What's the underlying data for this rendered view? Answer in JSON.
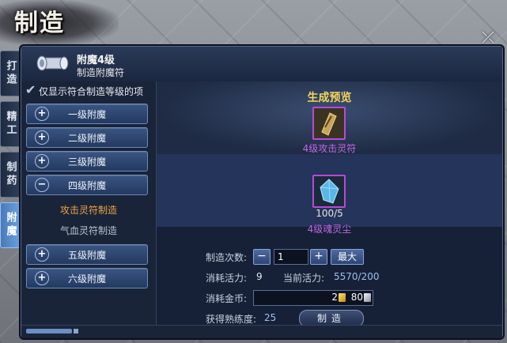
{
  "window": {
    "title": "制造",
    "close_icon": "close-x-icon"
  },
  "side_tabs": [
    {
      "label": "打造",
      "active": false
    },
    {
      "label": "精工",
      "active": false
    },
    {
      "label": "制药",
      "active": false
    },
    {
      "label": "附魔",
      "active": true
    }
  ],
  "header": {
    "item_name": "附魔4级",
    "item_sub": "制造附魔符"
  },
  "filter": {
    "label": "仅显示符合制造等级的项",
    "checked": true
  },
  "categories": [
    {
      "label": "一级附魔",
      "sign": "+"
    },
    {
      "label": "二级附魔",
      "sign": "+"
    },
    {
      "label": "三级附魔",
      "sign": "+"
    },
    {
      "label": "四级附魔",
      "sign": "−"
    },
    {
      "label": "五级附魔",
      "sign": "+"
    },
    {
      "label": "六级附魔",
      "sign": "+"
    }
  ],
  "sub_items": [
    {
      "label": "攻击灵符制造",
      "active": true
    },
    {
      "label": "气血灵符制造",
      "active": false
    }
  ],
  "preview": {
    "title": "生成预览",
    "product_name": "4级攻击灵符",
    "material_count": "100/5",
    "material_name": "4级魂灵尘"
  },
  "form": {
    "craft_count_label": "制造次数:",
    "count_value": "1",
    "minus": "−",
    "plus": "+",
    "max_label": "最大",
    "energy_cost_label": "消耗活力:",
    "energy_cost_value": "9",
    "current_energy_label": "当前活力:",
    "current_energy_value": "5570/200",
    "gold_cost_label": "消耗金币:",
    "gold_value": "2",
    "silver_value": "80",
    "proficiency_label": "获得熟练度:",
    "proficiency_value": "25",
    "craft_button": "制造"
  },
  "colors": {
    "accent_purple": "#c067e4",
    "title_yellow": "#f3d55a",
    "active_orange": "#f0a24a"
  }
}
